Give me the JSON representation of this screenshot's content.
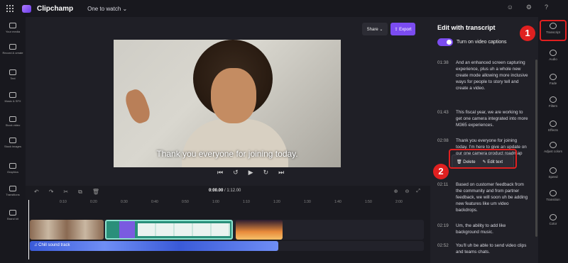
{
  "topbar": {
    "app_name": "Clipchamp",
    "project": "One to watch ⌄"
  },
  "leftbar": {
    "items": [
      "Your media",
      "Record & create",
      "Text",
      "Music & SFX",
      "Stock video",
      "Stock images",
      "Graphics",
      "Transitions",
      "Brand kit"
    ]
  },
  "stage": {
    "share_label": "Share ⌄",
    "export_label": "⇪ Export",
    "caption": "Thank you everyone for joining today."
  },
  "timeline": {
    "current_time": "0:00.00",
    "total_time": "/ 1:12.00",
    "ruler": [
      "0:10",
      "0:20",
      "0:30",
      "0:40",
      "0:50",
      "1:00",
      "1:10",
      "1:20",
      "1:30",
      "1:40",
      "1:50",
      "2:00",
      "2:10",
      "2:20"
    ],
    "audio_track": "♫ Chill sound track"
  },
  "panel": {
    "title": "Edit with transcript",
    "toggle_label": "Turn on video captions",
    "entries": [
      {
        "time": "01:38",
        "text": "And an enhanced screen capturing experience, plus uh a whole new create mode allowing more inclusive ways for people to story tell and create a video."
      },
      {
        "time": "01:43",
        "text": "This fiscal year, we are working to get one camera integrated into more M365 experiences."
      },
      {
        "time": "02:08",
        "text": "Thank you everyone for joining today. I'm here to give an update on our one camera product roadmap on the last quarter."
      },
      {
        "time": "02:11",
        "text": "Based on customer feedback from the community and from partner feedback, we will soon uh be adding new features like um video backdrops."
      },
      {
        "time": "02:19",
        "text": "Um, the ability to add like background music."
      },
      {
        "time": "02:52",
        "text": "You'll uh be able to send video clips and teams chats."
      }
    ],
    "popup": {
      "delete": "Delete",
      "edit": "Edit text"
    }
  },
  "rightbar": {
    "items": [
      "Transcript",
      "Audio",
      "Fade",
      "Filters",
      "Effects",
      "Adjust colors",
      "Speed",
      "Transition",
      "Color"
    ]
  },
  "annotations": {
    "one": "1",
    "two": "2"
  }
}
